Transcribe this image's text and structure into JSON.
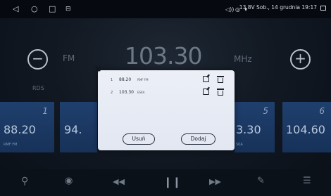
{
  "status_bar": {
    "text": "13.8V  Sob., 14 grudnia 19:17",
    "icons": [
      "back-icon",
      "home-icon",
      "recents-icon",
      "cast-icon",
      "volume-icon",
      "hotspot-icon",
      "wifi-icon",
      "battery-icon",
      "window-icon"
    ]
  },
  "tuner": {
    "band": "FM",
    "frequency": "103.30",
    "unit": "MHz",
    "rds_label": "RDS",
    "minus": "−",
    "plus": "+"
  },
  "presets": [
    {
      "num": "1",
      "freq": "88.20",
      "name": "RMF FM"
    },
    {
      "num": "",
      "freq": "94.",
      "name": ""
    },
    {
      "num": "5",
      "freq": "3.30",
      "name": "SKA"
    },
    {
      "num": "6",
      "freq": "104.60",
      "name": ""
    }
  ],
  "dialog": {
    "close": "×",
    "rows": [
      {
        "idx": "1",
        "freq": "88.20",
        "name": "RMF FM"
      },
      {
        "idx": "2",
        "freq": "103.30",
        "name": "ESKA"
      }
    ],
    "delete_button": "Usuń",
    "add_button": "Dodaj"
  },
  "bottom_bar": {
    "icons": [
      "search-icon",
      "radio-scan-icon",
      "rewind-icon",
      "pause-icon",
      "fast-forward-icon",
      "edit-icon",
      "equalizer-icon"
    ]
  },
  "colors": {
    "preset_bg": "#1f3f6d",
    "dialog_bg": "#eceff6"
  }
}
